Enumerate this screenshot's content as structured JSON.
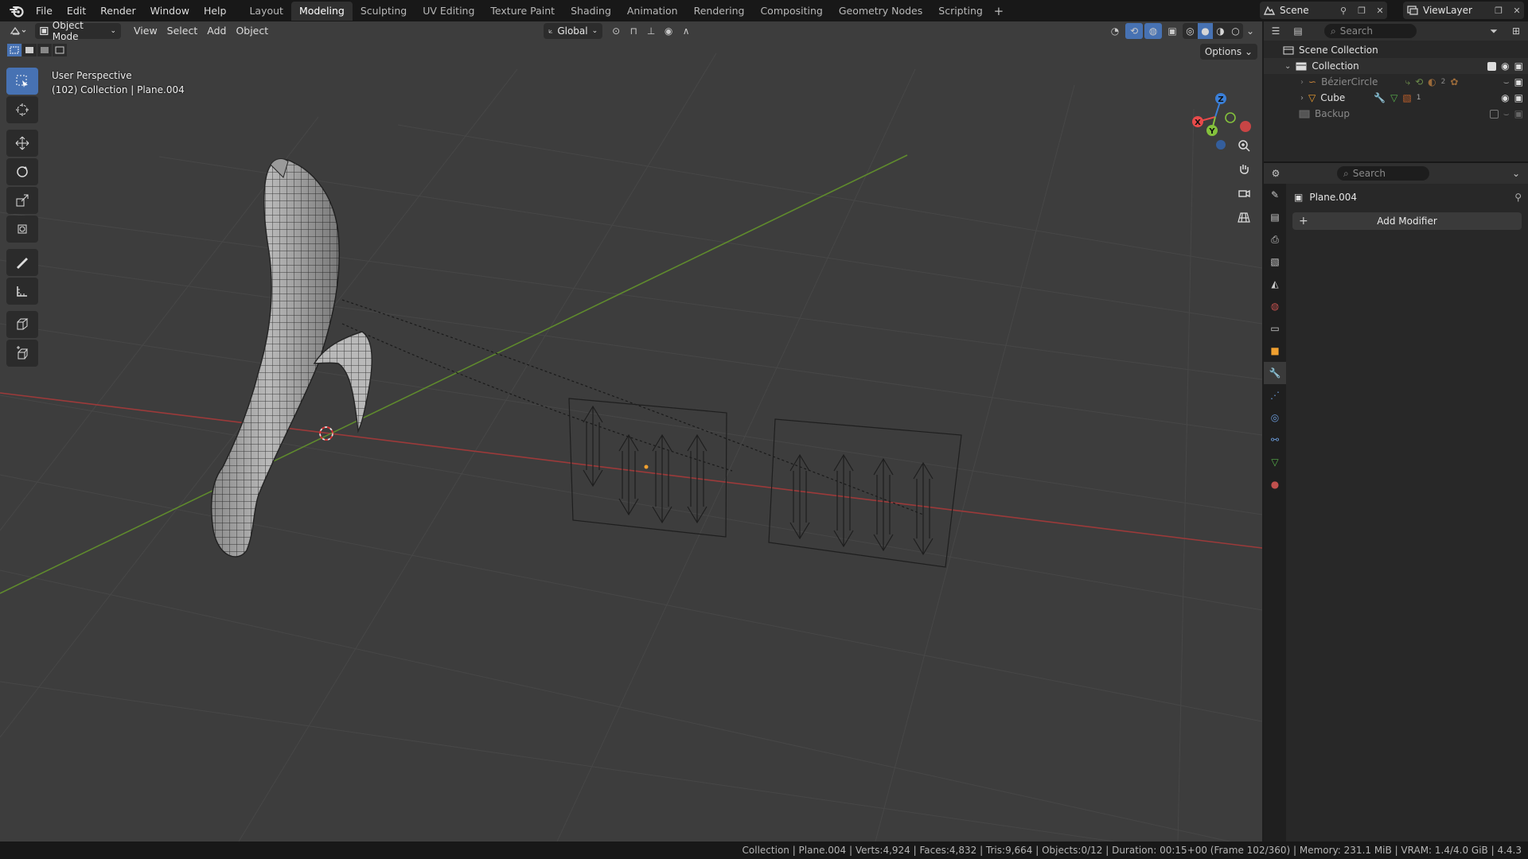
{
  "menubar": {
    "items": [
      "File",
      "Edit",
      "Render",
      "Window",
      "Help"
    ],
    "workspaces": [
      "Layout",
      "Modeling",
      "Sculpting",
      "UV Editing",
      "Texture Paint",
      "Shading",
      "Animation",
      "Rendering",
      "Compositing",
      "Geometry Nodes",
      "Scripting"
    ],
    "active_workspace": "Modeling",
    "scene": "Scene",
    "view_layer": "ViewLayer"
  },
  "viewport": {
    "mode": "Object Mode",
    "menus": [
      "View",
      "Select",
      "Add",
      "Object"
    ],
    "orientation": "Global",
    "options_label": "Options",
    "view_name": "User Perspective",
    "context_line": "(102) Collection | Plane.004",
    "gizmo_axes": [
      "X",
      "Y",
      "Z"
    ]
  },
  "outliner": {
    "search_placeholder": "Search",
    "rows": [
      {
        "label": "Scene Collection"
      },
      {
        "label": "Collection"
      },
      {
        "label": "BézierCircle"
      },
      {
        "label": "Cube"
      },
      {
        "label": "Backup"
      }
    ],
    "badges": [
      "2",
      "1"
    ]
  },
  "properties": {
    "search_placeholder": "Search",
    "object_name": "Plane.004",
    "add_modifier_label": "Add Modifier"
  },
  "statusbar": {
    "text": "Collection | Plane.004 | Verts:4,924 | Faces:4,832 | Tris:9,664 | Objects:0/12 | Duration: 00:15+00 (Frame 102/360) | Memory: 231.1 MiB | VRAM: 1.4/4.0 GiB | 4.4.3"
  },
  "colors": {
    "accent": "#4772b3",
    "axis_x": "#e84a4a",
    "axis_y": "#84c13c",
    "axis_z": "#3a7fd8",
    "viewport_bg": "#3d3d3d"
  }
}
